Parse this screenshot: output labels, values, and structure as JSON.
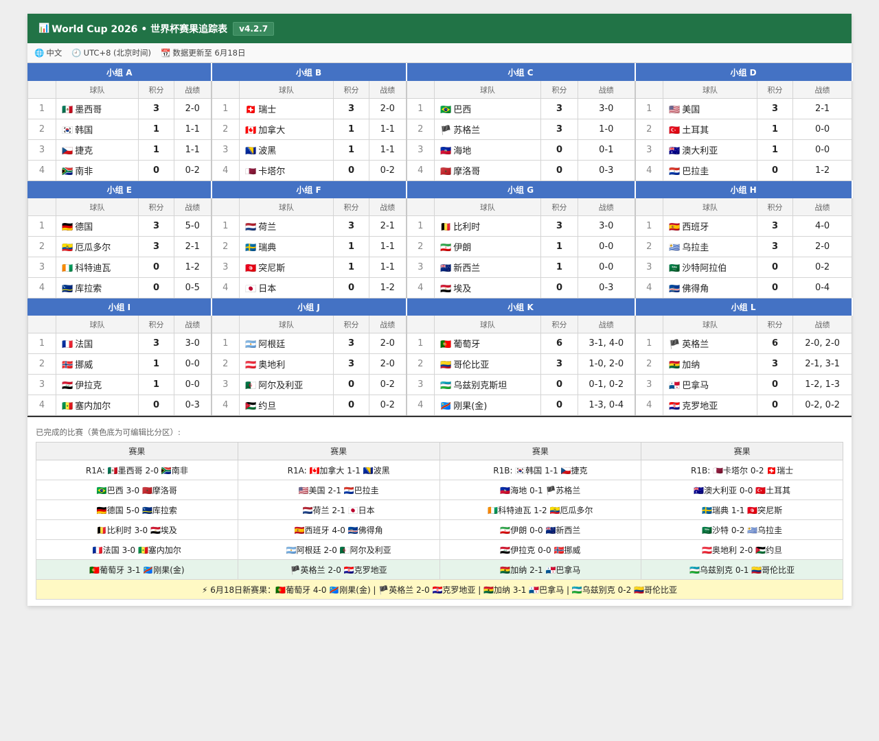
{
  "header": {
    "icon": "📊",
    "title": "World Cup 2026 • 世界杯赛果追踪表",
    "version": "v4.2.7"
  },
  "infobar": [
    {
      "icon": "🌐",
      "icon_name": "globe-icon",
      "text": "中文"
    },
    {
      "icon": "🕘",
      "icon_name": "clock-icon",
      "text": "UTC+8 (北京时间)"
    },
    {
      "icon": "📆",
      "icon_name": "calendar-icon",
      "text": "数据更新至 6月18日"
    }
  ],
  "columns": {
    "team": "球队",
    "pts": "积分",
    "rec": "战绩"
  },
  "groups": [
    {
      "name": "小组 A",
      "rows": [
        {
          "rank": "1",
          "flag": "🇲🇽",
          "team": "墨西哥",
          "pts": "3",
          "rec": "2-0"
        },
        {
          "rank": "2",
          "flag": "🇰🇷",
          "team": "韩国",
          "pts": "1",
          "rec": "1-1"
        },
        {
          "rank": "3",
          "flag": "🇨🇿",
          "team": "捷克",
          "pts": "1",
          "rec": "1-1"
        },
        {
          "rank": "4",
          "flag": "🇿🇦",
          "team": "南非",
          "pts": "0",
          "rec": "0-2"
        }
      ]
    },
    {
      "name": "小组 B",
      "rows": [
        {
          "rank": "1",
          "flag": "🇨🇭",
          "team": "瑞士",
          "pts": "3",
          "rec": "2-0"
        },
        {
          "rank": "2",
          "flag": "🇨🇦",
          "team": "加拿大",
          "pts": "1",
          "rec": "1-1"
        },
        {
          "rank": "3",
          "flag": "🇧🇦",
          "team": "波黑",
          "pts": "1",
          "rec": "1-1"
        },
        {
          "rank": "4",
          "flag": "🇶🇦",
          "team": "卡塔尔",
          "pts": "0",
          "rec": "0-2"
        }
      ]
    },
    {
      "name": "小组 C",
      "rows": [
        {
          "rank": "1",
          "flag": "🇧🇷",
          "team": "巴西",
          "pts": "3",
          "rec": "3-0"
        },
        {
          "rank": "2",
          "flag": "🏴",
          "team": "苏格兰",
          "pts": "3",
          "rec": "1-0"
        },
        {
          "rank": "3",
          "flag": "🇭🇹",
          "team": "海地",
          "pts": "0",
          "rec": "0-1"
        },
        {
          "rank": "4",
          "flag": "🇲🇦",
          "team": "摩洛哥",
          "pts": "0",
          "rec": "0-3"
        }
      ]
    },
    {
      "name": "小组 D",
      "rows": [
        {
          "rank": "1",
          "flag": "🇺🇸",
          "team": "美国",
          "pts": "3",
          "rec": "2-1"
        },
        {
          "rank": "2",
          "flag": "🇹🇷",
          "team": "土耳其",
          "pts": "1",
          "rec": "0-0"
        },
        {
          "rank": "3",
          "flag": "🇦🇺",
          "team": "澳大利亚",
          "pts": "1",
          "rec": "0-0"
        },
        {
          "rank": "4",
          "flag": "🇵🇾",
          "team": "巴拉圭",
          "pts": "0",
          "rec": "1-2"
        }
      ]
    },
    {
      "name": "小组 E",
      "rows": [
        {
          "rank": "1",
          "flag": "🇩🇪",
          "team": "德国",
          "pts": "3",
          "rec": "5-0"
        },
        {
          "rank": "2",
          "flag": "🇪🇨",
          "team": "厄瓜多尔",
          "pts": "3",
          "rec": "2-1"
        },
        {
          "rank": "3",
          "flag": "🇨🇮",
          "team": "科特迪瓦",
          "pts": "0",
          "rec": "1-2"
        },
        {
          "rank": "4",
          "flag": "🇨🇼",
          "team": "库拉索",
          "pts": "0",
          "rec": "0-5"
        }
      ]
    },
    {
      "name": "小组 F",
      "rows": [
        {
          "rank": "1",
          "flag": "🇳🇱",
          "team": "荷兰",
          "pts": "3",
          "rec": "2-1"
        },
        {
          "rank": "2",
          "flag": "🇸🇪",
          "team": "瑞典",
          "pts": "1",
          "rec": "1-1"
        },
        {
          "rank": "3",
          "flag": "🇹🇳",
          "team": "突尼斯",
          "pts": "1",
          "rec": "1-1"
        },
        {
          "rank": "4",
          "flag": "🇯🇵",
          "team": "日本",
          "pts": "0",
          "rec": "1-2"
        }
      ]
    },
    {
      "name": "小组 G",
      "rows": [
        {
          "rank": "1",
          "flag": "🇧🇪",
          "team": "比利时",
          "pts": "3",
          "rec": "3-0"
        },
        {
          "rank": "2",
          "flag": "🇮🇷",
          "team": "伊朗",
          "pts": "1",
          "rec": "0-0"
        },
        {
          "rank": "3",
          "flag": "🇳🇿",
          "team": "新西兰",
          "pts": "1",
          "rec": "0-0"
        },
        {
          "rank": "4",
          "flag": "🇪🇬",
          "team": "埃及",
          "pts": "0",
          "rec": "0-3"
        }
      ]
    },
    {
      "name": "小组 H",
      "rows": [
        {
          "rank": "1",
          "flag": "🇪🇸",
          "team": "西班牙",
          "pts": "3",
          "rec": "4-0"
        },
        {
          "rank": "2",
          "flag": "🇺🇾",
          "team": "乌拉圭",
          "pts": "3",
          "rec": "2-0"
        },
        {
          "rank": "3",
          "flag": "🇸🇦",
          "team": "沙特阿拉伯",
          "pts": "0",
          "rec": "0-2"
        },
        {
          "rank": "4",
          "flag": "🇨🇻",
          "team": "佛得角",
          "pts": "0",
          "rec": "0-4"
        }
      ]
    },
    {
      "name": "小组 I",
      "rows": [
        {
          "rank": "1",
          "flag": "🇫🇷",
          "team": "法国",
          "pts": "3",
          "rec": "3-0"
        },
        {
          "rank": "2",
          "flag": "🇳🇴",
          "team": "挪威",
          "pts": "1",
          "rec": "0-0"
        },
        {
          "rank": "3",
          "flag": "🇮🇶",
          "team": "伊拉克",
          "pts": "1",
          "rec": "0-0"
        },
        {
          "rank": "4",
          "flag": "🇸🇳",
          "team": "塞内加尔",
          "pts": "0",
          "rec": "0-3"
        }
      ]
    },
    {
      "name": "小组 J",
      "rows": [
        {
          "rank": "1",
          "flag": "🇦🇷",
          "team": "阿根廷",
          "pts": "3",
          "rec": "2-0"
        },
        {
          "rank": "2",
          "flag": "🇦🇹",
          "team": "奥地利",
          "pts": "3",
          "rec": "2-0"
        },
        {
          "rank": "3",
          "flag": "🇩🇿",
          "team": "阿尔及利亚",
          "pts": "0",
          "rec": "0-2"
        },
        {
          "rank": "4",
          "flag": "🇯🇴",
          "team": "约旦",
          "pts": "0",
          "rec": "0-2"
        }
      ]
    },
    {
      "name": "小组 K",
      "rows": [
        {
          "rank": "1",
          "flag": "🇵🇹",
          "team": "葡萄牙",
          "pts": "6",
          "rec": "3-1, 4-0"
        },
        {
          "rank": "2",
          "flag": "🇨🇴",
          "team": "哥伦比亚",
          "pts": "3",
          "rec": "1-0, 2-0"
        },
        {
          "rank": "3",
          "flag": "🇺🇿",
          "team": "乌兹别克斯坦",
          "pts": "0",
          "rec": "0-1, 0-2"
        },
        {
          "rank": "4",
          "flag": "🇨🇩",
          "team": "刚果(金)",
          "pts": "0",
          "rec": "1-3, 0-4"
        }
      ]
    },
    {
      "name": "小组 L",
      "rows": [
        {
          "rank": "1",
          "flag": "🏴",
          "team": "英格兰",
          "pts": "6",
          "rec": "2-0, 2-0"
        },
        {
          "rank": "2",
          "flag": "🇬🇭",
          "team": "加纳",
          "pts": "3",
          "rec": "2-1, 3-1"
        },
        {
          "rank": "3",
          "flag": "🇵🇦",
          "team": "巴拿马",
          "pts": "0",
          "rec": "1-2, 1-3"
        },
        {
          "rank": "4",
          "flag": "🇭🇷",
          "team": "克罗地亚",
          "pts": "0",
          "rec": "0-2, 0-2"
        }
      ]
    }
  ],
  "results": {
    "title": "已完成的比赛（黄色底为可编辑比分区）:",
    "headers": [
      "赛果",
      "赛果",
      "赛果",
      "赛果"
    ],
    "rows": [
      [
        "R1A: 🇲🇽墨西哥 2-0 🇿🇦南非",
        "R1A: 🇨🇦加拿大 1-1 🇧🇦波黑",
        "R1B: 🇰🇷韩国 1-1 🇨🇿捷克",
        "R1B: 🇶🇦卡塔尔 0-2 🇨🇭瑞士"
      ],
      [
        "🇧🇷巴西 3-0 🇲🇦摩洛哥",
        "🇺🇸美国 2-1 🇵🇾巴拉圭",
        "🇭🇹海地 0-1 🏴苏格兰",
        "🇦🇺澳大利亚 0-0 🇹🇷土耳其"
      ],
      [
        "🇩🇪德国 5-0 🇨🇼库拉索",
        "🇳🇱荷兰 2-1 🇯🇵日本",
        "🇨🇮科特迪瓦 1-2 🇪🇨厄瓜多尔",
        "🇸🇪瑞典 1-1 🇹🇳突尼斯"
      ],
      [
        "🇧🇪比利时 3-0 🇪🇬埃及",
        "🇪🇸西班牙 4-0 🇨🇻佛得角",
        "🇮🇷伊朗 0-0 🇳🇿新西兰",
        "🇸🇦沙特 0-2 🇺🇾乌拉圭"
      ],
      [
        "🇫🇷法国 3-0 🇸🇳塞内加尔",
        "🇦🇷阿根廷 2-0 🇩🇿阿尔及利亚",
        "🇮🇶伊拉克 0-0 🇳🇴挪威",
        "🇦🇹奥地利 2-0 🇯🇴约旦"
      ],
      [
        "🇵🇹葡萄牙 3-1 🇨🇩刚果(金)",
        "🏴英格兰 2-0 🇭🇷克罗地亚",
        "🇬🇭加纳 2-1 🇵🇦巴拿马",
        "🇺🇿乌兹别克 0-1 🇨🇴哥伦比亚"
      ]
    ],
    "new_results": "⚡ 6月18日新赛果：🇵🇹葡萄牙 4-0 🇨🇩刚果(金) | 🏴英格兰 2-0 🇭🇷克罗地亚 | 🇬🇭加纳 3-1 🇵🇦巴拿马 | 🇺🇿乌兹别克 0-2 🇨🇴哥伦比亚"
  },
  "colors": {
    "header_bg": "#217346",
    "group_header_bg": "#4472c4",
    "highlight_row": "#e6f4ea",
    "editable_row": "#fff9c4"
  }
}
